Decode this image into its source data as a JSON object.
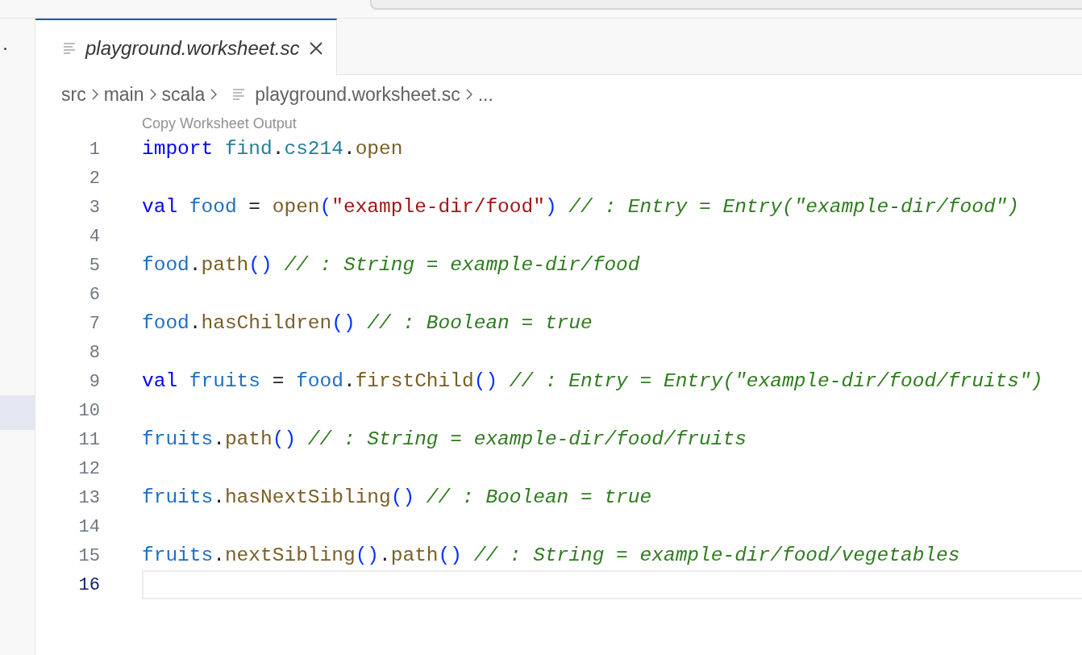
{
  "tab": {
    "title": "playground.worksheet.sc",
    "selected": true
  },
  "breadcrumbs": [
    {
      "label": "src",
      "kind": "folder"
    },
    {
      "label": "main",
      "kind": "folder"
    },
    {
      "label": "scala",
      "kind": "folder"
    },
    {
      "label": "playground.worksheet.sc",
      "kind": "file"
    },
    {
      "label": "...",
      "kind": "more"
    }
  ],
  "codelens": "Copy Worksheet Output",
  "lines": [
    {
      "number": "1",
      "current": false,
      "tokens": [
        {
          "t": "import ",
          "kind": "keyword"
        },
        {
          "t": "find",
          "kind": "namespace"
        },
        {
          "t": ".",
          "kind": "plain"
        },
        {
          "t": "cs214",
          "kind": "namespace"
        },
        {
          "t": ".",
          "kind": "plain"
        },
        {
          "t": "open",
          "kind": "method"
        }
      ]
    },
    {
      "number": "2",
      "current": false
    },
    {
      "number": "3",
      "current": false,
      "tokens": [
        {
          "t": "val ",
          "kind": "keyword"
        },
        {
          "t": "food",
          "kind": "variable"
        },
        {
          "t": " = ",
          "kind": "plain"
        },
        {
          "t": "open",
          "kind": "method"
        },
        {
          "t": "(",
          "kind": "paren"
        },
        {
          "t": "\"example-dir/food\"",
          "kind": "string"
        },
        {
          "t": ")",
          "kind": "paren"
        },
        {
          "t": " // : Entry = Entry(\"example-dir/food\")",
          "kind": "comment"
        }
      ]
    },
    {
      "number": "4",
      "current": false
    },
    {
      "number": "5",
      "current": false,
      "tokens": [
        {
          "t": "food",
          "kind": "variable"
        },
        {
          "t": ".",
          "kind": "plain"
        },
        {
          "t": "path",
          "kind": "method"
        },
        {
          "t": "()",
          "kind": "paren"
        },
        {
          "t": " // : String = example-dir/food",
          "kind": "comment"
        }
      ]
    },
    {
      "number": "6",
      "current": false
    },
    {
      "number": "7",
      "current": false,
      "tokens": [
        {
          "t": "food",
          "kind": "variable"
        },
        {
          "t": ".",
          "kind": "plain"
        },
        {
          "t": "hasChildren",
          "kind": "method"
        },
        {
          "t": "()",
          "kind": "paren"
        },
        {
          "t": " // : Boolean = true",
          "kind": "comment"
        }
      ]
    },
    {
      "number": "8",
      "current": false
    },
    {
      "number": "9",
      "current": false,
      "tokens": [
        {
          "t": "val ",
          "kind": "keyword"
        },
        {
          "t": "fruits",
          "kind": "variable"
        },
        {
          "t": " = ",
          "kind": "plain"
        },
        {
          "t": "food",
          "kind": "variable"
        },
        {
          "t": ".",
          "kind": "plain"
        },
        {
          "t": "firstChild",
          "kind": "method"
        },
        {
          "t": "()",
          "kind": "paren"
        },
        {
          "t": " // : Entry = Entry(\"example-dir/food/fruits\")",
          "kind": "comment"
        }
      ]
    },
    {
      "number": "10",
      "current": false
    },
    {
      "number": "11",
      "current": false,
      "tokens": [
        {
          "t": "fruits",
          "kind": "variable"
        },
        {
          "t": ".",
          "kind": "plain"
        },
        {
          "t": "path",
          "kind": "method"
        },
        {
          "t": "()",
          "kind": "paren"
        },
        {
          "t": " // : String = example-dir/food/fruits",
          "kind": "comment"
        }
      ]
    },
    {
      "number": "12",
      "current": false
    },
    {
      "number": "13",
      "current": false,
      "tokens": [
        {
          "t": "fruits",
          "kind": "variable"
        },
        {
          "t": ".",
          "kind": "plain"
        },
        {
          "t": "hasNextSibling",
          "kind": "method"
        },
        {
          "t": "()",
          "kind": "paren"
        },
        {
          "t": " // : Boolean = true",
          "kind": "comment"
        }
      ]
    },
    {
      "number": "14",
      "current": false
    },
    {
      "number": "15",
      "current": false,
      "tokens": [
        {
          "t": "fruits",
          "kind": "variable"
        },
        {
          "t": ".",
          "kind": "plain"
        },
        {
          "t": "nextSibling",
          "kind": "method"
        },
        {
          "t": "()",
          "kind": "paren"
        },
        {
          "t": ".",
          "kind": "plain"
        },
        {
          "t": "path",
          "kind": "method"
        },
        {
          "t": "()",
          "kind": "paren"
        },
        {
          "t": " // : String = example-dir/food/vegetables",
          "kind": "comment"
        }
      ]
    },
    {
      "number": "16",
      "current": true
    }
  ]
}
